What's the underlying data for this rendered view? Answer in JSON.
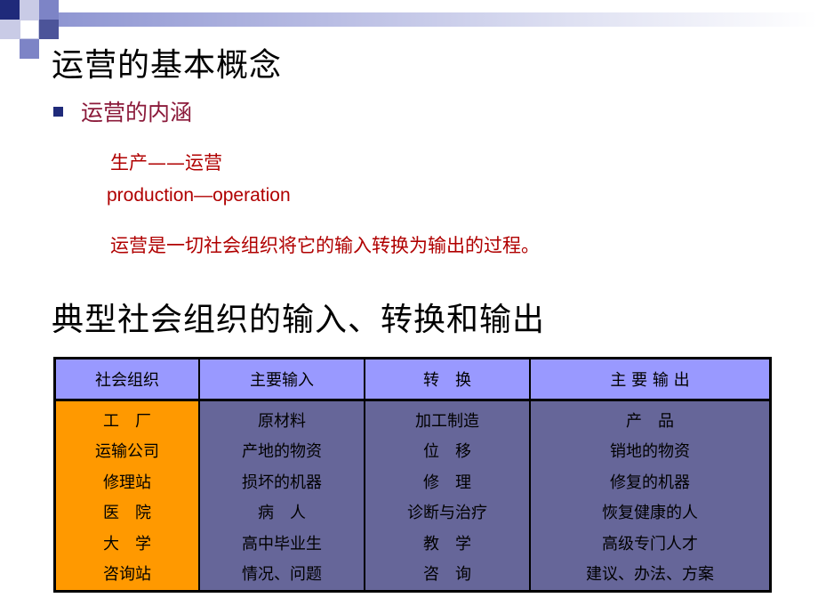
{
  "title": "运营的基本概念",
  "bullet": "运营的内涵",
  "lines": {
    "production_zh": "生产——运营",
    "production_en": "production—operation",
    "definition": "运营是一切社会组织将它的输入转换为输出的过程。"
  },
  "subtitle": "典型社会组织的输入、转换和输出",
  "table": {
    "headers": [
      "社会组织",
      "主要输入",
      "转　换",
      "主 要 输 出"
    ],
    "columns": [
      [
        "工　厂",
        "运输公司",
        "修理站",
        "医　院",
        "大　学",
        "咨询站"
      ],
      [
        "原材料",
        "产地的物资",
        "损坏的机器",
        "病　人",
        "高中毕业生",
        "情况、问题"
      ],
      [
        "加工制造",
        "位　移",
        "修　理",
        "诊断与治疗",
        "教　学",
        "咨　询"
      ],
      [
        "产　品",
        "销地的物资",
        "修复的机器",
        "恢复健康的人",
        "高级专门人才",
        "建议、办法、方案"
      ]
    ]
  },
  "colors": {
    "header_bg": "#9999ff",
    "first_col_bg": "#ff9900",
    "body_bg": "#666699",
    "accent_red": "#b00000",
    "bullet_text": "#8b1a3a"
  }
}
